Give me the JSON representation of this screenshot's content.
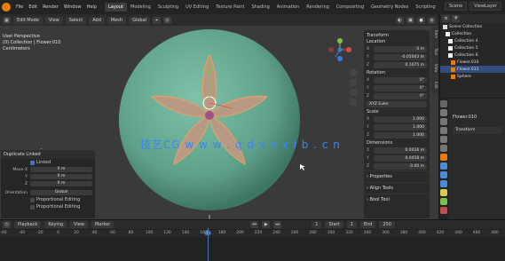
{
  "topbar": {
    "menus": [
      "File",
      "Edit",
      "Render",
      "Window",
      "Help"
    ],
    "workspaces": [
      "Layout",
      "Modeling",
      "Sculpting",
      "UV Editing",
      "Texture Paint",
      "Shading",
      "Animation",
      "Rendering",
      "Compositing",
      "Geometry Nodes",
      "Scripting"
    ],
    "active_workspace": "Layout",
    "scene_label": "Scene",
    "view_layer_label": "ViewLayer"
  },
  "viewport": {
    "mode": "Edit Mode",
    "view_menu": "View",
    "select_menu": "Select",
    "add_menu": "Add",
    "mesh_menu": "Mesh",
    "orientation": "Global",
    "info_lines": [
      "User Perspective",
      "(0) Collection | Flower.010",
      "Centimeters"
    ],
    "watermark": "技艺CG  w w w . q d x x x i b . c n"
  },
  "operator_panel": {
    "title": "Duplicate Linked",
    "linked_label": "Linked",
    "rows": [
      {
        "label": "Move X",
        "value": "0 m"
      },
      {
        "label": "Y",
        "value": "0 m"
      },
      {
        "label": "Z",
        "value": "0 m"
      }
    ],
    "orientation_label": "Orientation",
    "orientation_value": "Global",
    "checkboxes": [
      "Proportional Editing",
      "Proportional Editing"
    ]
  },
  "npanel": {
    "transform_title": "Transform",
    "location_label": "Location",
    "location": [
      {
        "axis": "X",
        "value": "0 m"
      },
      {
        "axis": "Y",
        "value": "-0.05043 m"
      },
      {
        "axis": "Z",
        "value": "0.1075 m"
      }
    ],
    "rotation_label": "Rotation",
    "rotation": [
      {
        "axis": "X",
        "value": "0°"
      },
      {
        "axis": "Y",
        "value": "0°"
      },
      {
        "axis": "Z",
        "value": "0°"
      }
    ],
    "rotation_mode": "XYZ Euler",
    "scale_label": "Scale",
    "scale": [
      {
        "axis": "X",
        "value": "1.000"
      },
      {
        "axis": "Y",
        "value": "1.000"
      },
      {
        "axis": "Z",
        "value": "1.000"
      }
    ],
    "dimensions_label": "Dimensions",
    "dimensions": [
      {
        "axis": "X",
        "value": "0.0416 m"
      },
      {
        "axis": "Y",
        "value": "0.0458 m"
      },
      {
        "axis": "Z",
        "value": "0.00 m"
      }
    ],
    "collapsed": [
      "Properties",
      "Align Tools",
      "Bool Tool"
    ],
    "tabs": [
      "Item",
      "Tool",
      "View",
      "Edit"
    ]
  },
  "outliner": {
    "rows": [
      {
        "label": "Scene Collection",
        "selected": false
      },
      {
        "label": "Collection",
        "selected": false
      },
      {
        "label": "Collection 4",
        "selected": false
      },
      {
        "label": "Collection 5",
        "selected": false
      },
      {
        "label": "Collection 6",
        "selected": false
      },
      {
        "label": "Flower.010",
        "selected": false
      },
      {
        "label": "Flower.011",
        "selected": true
      },
      {
        "label": "Sphere",
        "selected": false
      }
    ]
  },
  "properties": {
    "object_name": "Flower.010",
    "section": "Transform"
  },
  "timeline": {
    "playback": "Playback",
    "keying": "Keying",
    "view": "View",
    "marker": "Marker",
    "current_frame": "1",
    "start_label": "Start",
    "start": "1",
    "end_label": "End",
    "end": "250",
    "ticks": [
      "-60",
      "-40",
      "-20",
      "0",
      "20",
      "40",
      "60",
      "80",
      "100",
      "120",
      "140",
      "160",
      "180",
      "200",
      "220",
      "240",
      "260",
      "280",
      "300",
      "320",
      "340",
      "360",
      "380",
      "400",
      "420",
      "440",
      "460",
      "480"
    ]
  },
  "colors": {
    "sphere": "#5fa08a",
    "petal": "#b89a84",
    "accent": "#4772b3",
    "blender_orange": "#e87d0d"
  }
}
